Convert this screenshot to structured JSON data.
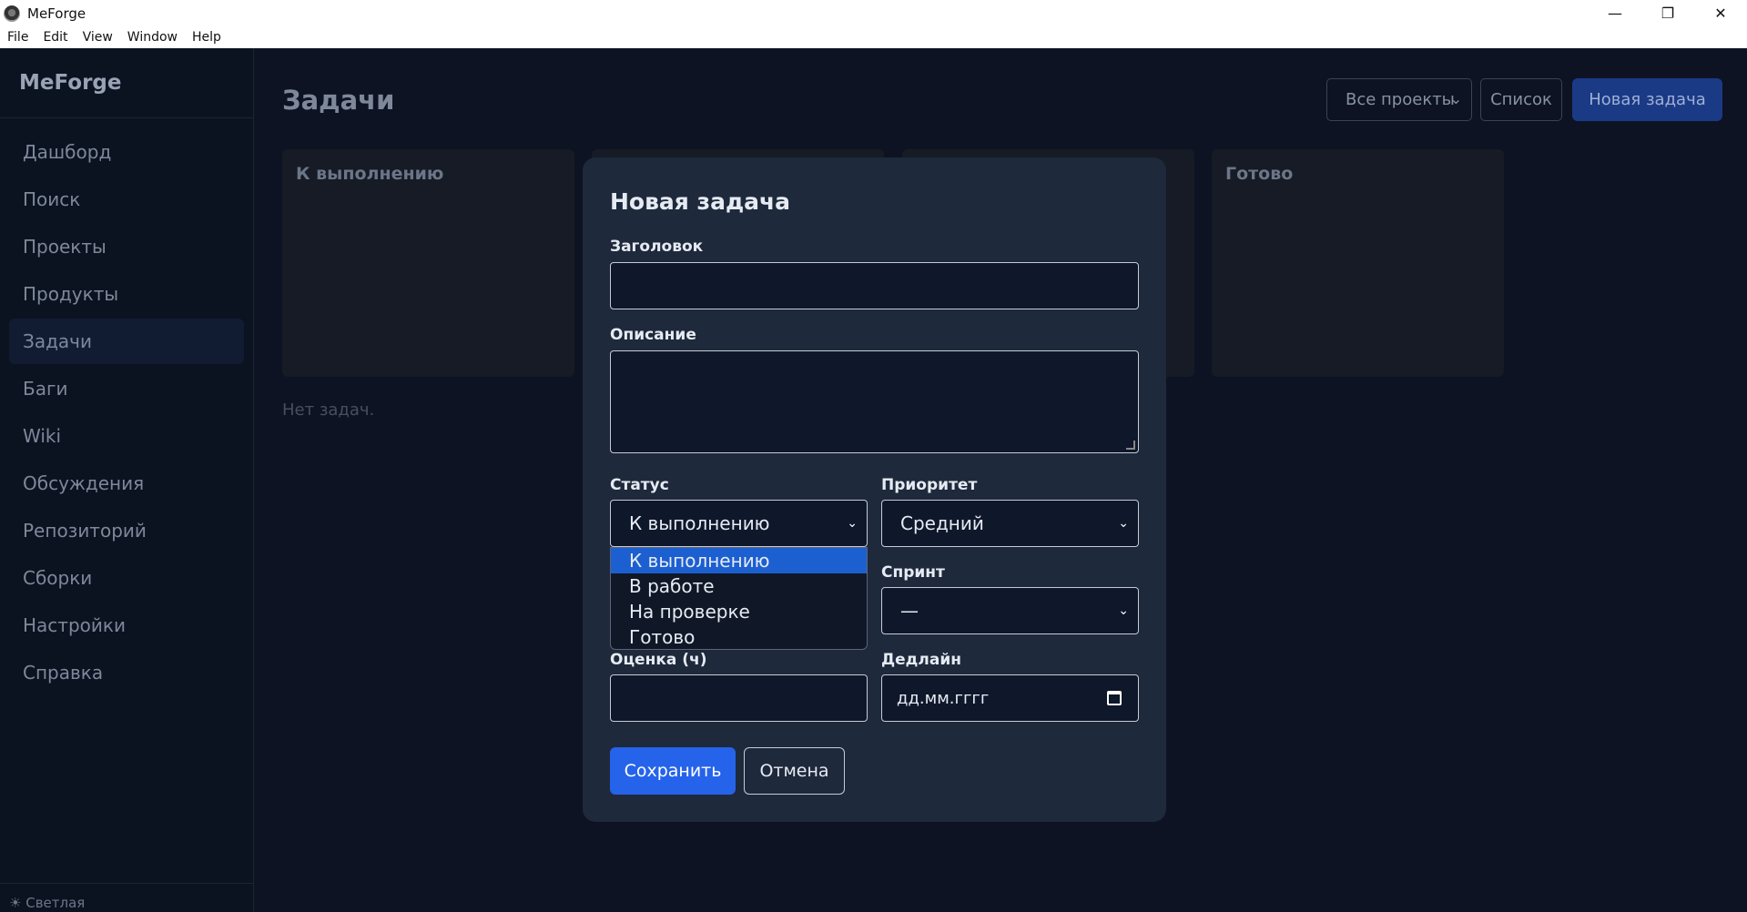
{
  "window": {
    "title": "MeForge",
    "controls": [
      "—",
      "❐",
      "✕"
    ]
  },
  "menu": [
    "File",
    "Edit",
    "View",
    "Window",
    "Help"
  ],
  "sidebar": {
    "brand": "MeForge",
    "items": [
      {
        "label": "Дашборд"
      },
      {
        "label": "Поиск"
      },
      {
        "label": "Проекты"
      },
      {
        "label": "Продукты"
      },
      {
        "label": "Задачи"
      },
      {
        "label": "Баги"
      },
      {
        "label": "Wiki"
      },
      {
        "label": "Обсуждения"
      },
      {
        "label": "Репозиторий"
      },
      {
        "label": "Сборки"
      },
      {
        "label": "Настройки"
      },
      {
        "label": "Справка"
      }
    ],
    "active_index": 4,
    "footer": "☀ Светлая"
  },
  "main": {
    "title": "Задачи",
    "project_filter": "Все проекты",
    "list_button": "Список",
    "new_task_button": "Новая задача",
    "columns": [
      {
        "title": "К выполнению"
      },
      {
        "title": ""
      },
      {
        "title": ""
      },
      {
        "title": "Готово"
      }
    ],
    "empty_text": "Нет задач."
  },
  "modal": {
    "title": "Новая задача",
    "labels": {
      "title": "Заголовок",
      "description": "Описание",
      "status": "Статус",
      "priority": "Приоритет",
      "sprint": "Спринт",
      "estimate": "Оценка (ч)",
      "deadline": "Дедлайн"
    },
    "values": {
      "title": "",
      "description": "",
      "status": "К выполнению",
      "priority": "Средний",
      "sprint": "—",
      "estimate": "",
      "deadline_placeholder": "дд.мм.гггг"
    },
    "status_options": [
      "К выполнению",
      "В работе",
      "На проверке",
      "Готово"
    ],
    "status_selected_index": 0,
    "save_button": "Сохранить",
    "cancel_button": "Отмена"
  },
  "colors": {
    "accent": "#2563eb",
    "modal_bg": "#1e293b",
    "page_bg": "#0d1322",
    "dropdown_selected": "#1c5fd0"
  }
}
